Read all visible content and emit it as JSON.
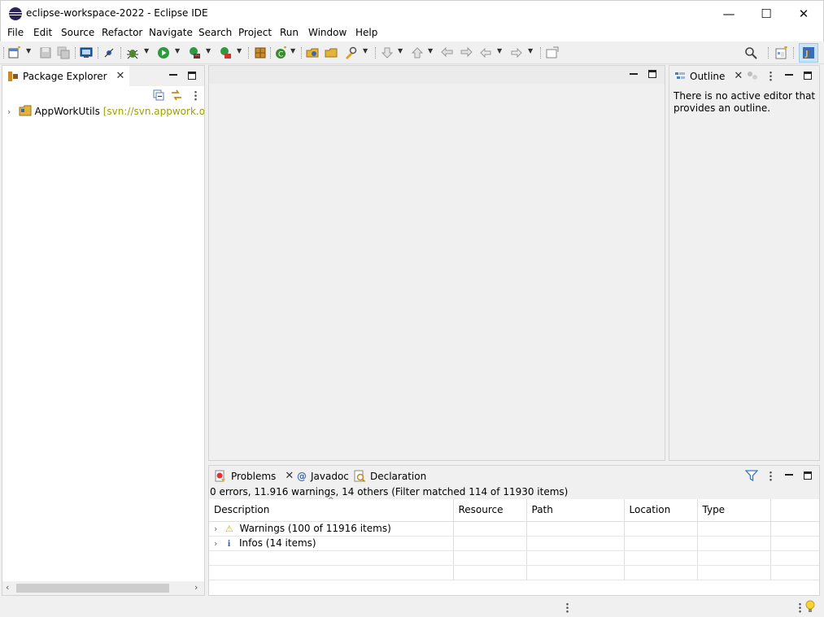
{
  "window": {
    "title": "eclipse-workspace-2022 - Eclipse IDE",
    "minimize_label": "—",
    "maximize_label": "☐",
    "close_label": "✕"
  },
  "menu": [
    "File",
    "Edit",
    "Source",
    "Refactor",
    "Navigate",
    "Search",
    "Project",
    "Run",
    "Window",
    "Help"
  ],
  "package_explorer": {
    "tab_label": "Package Explorer",
    "tree": [
      {
        "label": "AppWorkUtils",
        "decoration": "[svn://svn.appwork.org/u"
      }
    ]
  },
  "outline": {
    "tab_label": "Outline",
    "message": "There is no active editor that provides an outline."
  },
  "bottom": {
    "tabs": [
      "Problems",
      "Javadoc",
      "Declaration"
    ],
    "summary": "0 errors, 11.916 warnings, 14 others (Filter matched 114 of 11930 items)",
    "columns": [
      "Description",
      "Resource",
      "Path",
      "Location",
      "Type"
    ],
    "rows": [
      {
        "icon": "warning-icon",
        "label": "Warnings (100 of 11916 items)"
      },
      {
        "icon": "info-icon",
        "label": "Infos (14 items)"
      }
    ]
  },
  "colors": {
    "link_gray": "#a0a000",
    "accent": "#1a3e88",
    "selected_toggle": "#cce4f7"
  }
}
